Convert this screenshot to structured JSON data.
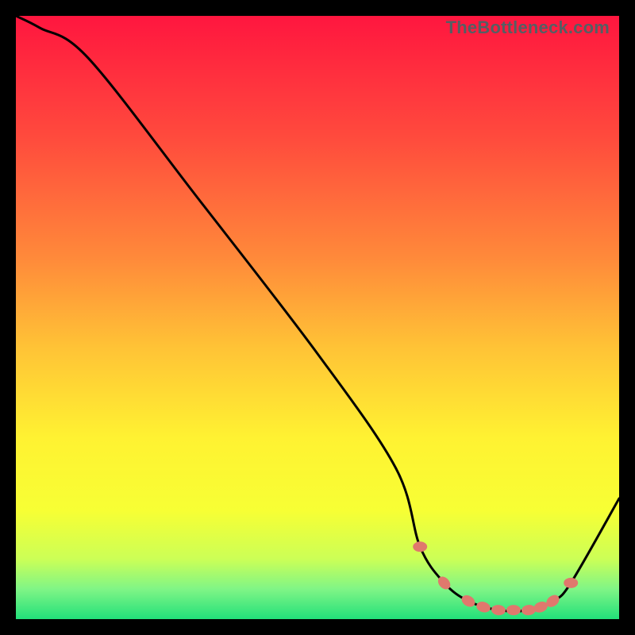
{
  "watermark": "TheBottleneck.com",
  "chart_data": {
    "type": "line",
    "title": "",
    "xlabel": "",
    "ylabel": "",
    "xlim": [
      0,
      100
    ],
    "ylim": [
      0,
      100
    ],
    "grid": false,
    "legend": false,
    "annotations": [],
    "series": [
      {
        "name": "curve",
        "color": "#000000",
        "x": [
          0,
          4,
          12,
          30,
          50,
          63,
          67,
          71,
          75,
          80,
          85,
          89,
          92,
          100
        ],
        "y": [
          100,
          98,
          93,
          70,
          44,
          25,
          12,
          6,
          3,
          1.5,
          1.5,
          3,
          6,
          20
        ]
      }
    ],
    "markers": {
      "name": "highlight-dots",
      "color": "#e0786d",
      "x": [
        67,
        71,
        75,
        77.5,
        80,
        82.5,
        85,
        87,
        89,
        92
      ],
      "y": [
        12,
        6,
        3,
        2,
        1.5,
        1.5,
        1.5,
        2,
        3,
        6
      ]
    },
    "background_gradient_stops": [
      {
        "offset": 0.0,
        "color": "#ff163f"
      },
      {
        "offset": 0.2,
        "color": "#ff4a3d"
      },
      {
        "offset": 0.4,
        "color": "#ff893a"
      },
      {
        "offset": 0.55,
        "color": "#ffc336"
      },
      {
        "offset": 0.7,
        "color": "#fff232"
      },
      {
        "offset": 0.82,
        "color": "#f7ff34"
      },
      {
        "offset": 0.9,
        "color": "#ccff56"
      },
      {
        "offset": 0.95,
        "color": "#80f586"
      },
      {
        "offset": 1.0,
        "color": "#22e07a"
      }
    ]
  }
}
